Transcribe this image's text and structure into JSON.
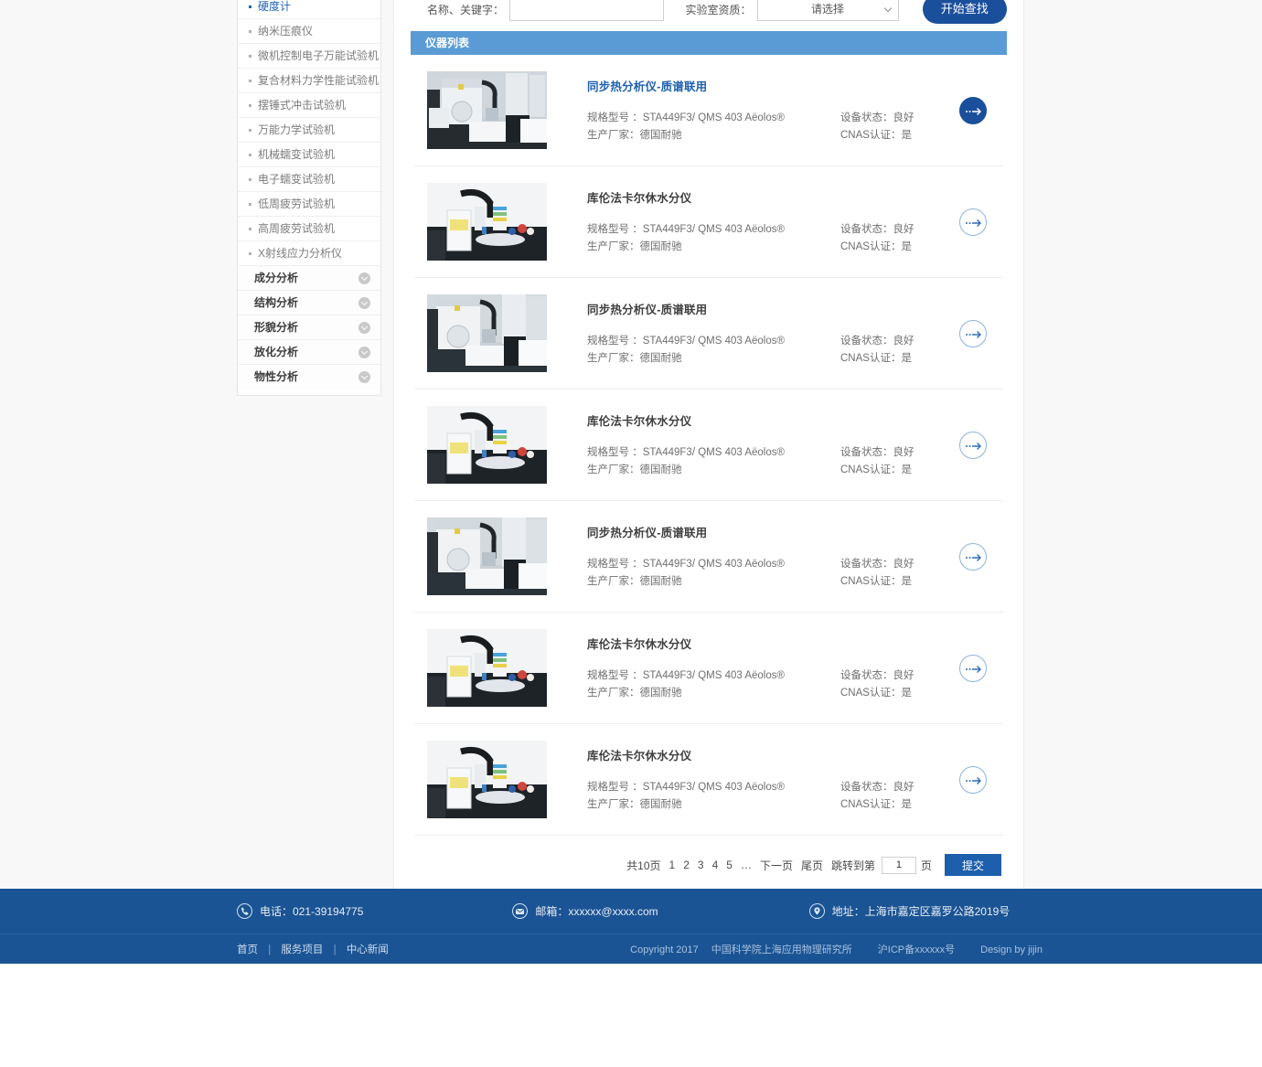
{
  "sidebar": {
    "leaf_items": [
      {
        "label": "硬度计",
        "active": true
      },
      {
        "label": "纳米压痕仪",
        "active": false
      },
      {
        "label": "微机控制电子万能试验机",
        "active": false
      },
      {
        "label": "复合材料力学性能试验机",
        "active": false
      },
      {
        "label": "摆锤式冲击试验机",
        "active": false
      },
      {
        "label": "万能力学试验机",
        "active": false
      },
      {
        "label": "机械蠕变试验机",
        "active": false
      },
      {
        "label": "电子蠕变试验机",
        "active": false
      },
      {
        "label": "低周疲劳试验机",
        "active": false
      },
      {
        "label": "高周疲劳试验机",
        "active": false
      },
      {
        "label": "X射线应力分析仪",
        "active": false
      }
    ],
    "groups": [
      {
        "label": "成分分析",
        "icon": "chevron-down-icon"
      },
      {
        "label": "结构分析",
        "icon": "chevron-down-icon"
      },
      {
        "label": "形貌分析",
        "icon": "chevron-down-icon"
      },
      {
        "label": "放化分析",
        "icon": "chevron-down-icon"
      },
      {
        "label": "物性分析",
        "icon": "chevron-down-icon"
      }
    ]
  },
  "search": {
    "keyword_label": "名称、关键字：",
    "keyword_value": "",
    "keyword_placeholder": "",
    "qualification_label": "实验室资质：",
    "qualification_selected": "请选择",
    "qualification_options": [
      "请选择"
    ],
    "submit_label": "开始查找"
  },
  "list": {
    "header": "仪器列表",
    "labels": {
      "model": "规格型号",
      "manufacturer": "生产厂家",
      "status": "设备状态",
      "cnas": "CNAS认证"
    },
    "items": [
      {
        "title": "同步热分析仪-质谱联用",
        "model": "规格型号 ：STA449F3/ QMS 403 Aëolos®",
        "manufacturer": "生产厂家：德国耐驰",
        "status": "设备状态：良好",
        "cnas": "CNAS认证：是",
        "featured": true,
        "image": "instrument-photo-1"
      },
      {
        "title": "库伦法卡尔休水分仪",
        "model": "规格型号 ：STA449F3/ QMS 403 Aëolos®",
        "manufacturer": "生产厂家：德国耐驰",
        "status": "设备状态：良好",
        "cnas": "CNAS认证：是",
        "featured": false,
        "image": "instrument-photo-2"
      },
      {
        "title": "同步热分析仪-质谱联用",
        "model": "规格型号 ：STA449F3/ QMS 403 Aëolos®",
        "manufacturer": "生产厂家：德国耐驰",
        "status": "设备状态：良好",
        "cnas": "CNAS认证：是",
        "featured": false,
        "image": "instrument-photo-3"
      },
      {
        "title": "库伦法卡尔休水分仪",
        "model": "规格型号 ：STA449F3/ QMS 403 Aëolos®",
        "manufacturer": "生产厂家：德国耐驰",
        "status": "设备状态：良好",
        "cnas": "CNAS认证：是",
        "featured": false,
        "image": "instrument-photo-2"
      },
      {
        "title": "同步热分析仪-质谱联用",
        "model": "规格型号 ：STA449F3/ QMS 403 Aëolos®",
        "manufacturer": "生产厂家：德国耐驰",
        "status": "设备状态：良好",
        "cnas": "CNAS认证：是",
        "featured": false,
        "image": "instrument-photo-3"
      },
      {
        "title": "库伦法卡尔休水分仪",
        "model": "规格型号 ：STA449F3/ QMS 403 Aëolos®",
        "manufacturer": "生产厂家：德国耐驰",
        "status": "设备状态：良好",
        "cnas": "CNAS认证：是",
        "featured": false,
        "image": "instrument-photo-2"
      },
      {
        "title": "库伦法卡尔休水分仪",
        "model": "规格型号 ：STA449F3/ QMS 403 Aëolos®",
        "manufacturer": "生产厂家：德国耐驰",
        "status": "设备状态：良好",
        "cnas": "CNAS认证：是",
        "featured": false,
        "image": "instrument-photo-2"
      }
    ]
  },
  "pagination": {
    "total_text": "共10页",
    "pages": [
      "1",
      "2",
      "3",
      "4",
      "5"
    ],
    "ellipsis": "…",
    "next_label": "下一页",
    "last_label": "尾页",
    "jump_prefix": "跳转到第",
    "jump_value": "1",
    "jump_suffix": "页",
    "submit_label": "提交"
  },
  "footer": {
    "phone": "电话：021-39194775",
    "phone_icon": "phone-icon",
    "email": "邮箱：xxxxxx@xxxx.com",
    "email_icon": "mail-icon",
    "address": "地址：上海市嘉定区嘉罗公路2019号",
    "address_icon": "location-pin-icon",
    "nav": [
      "首页",
      "服务项目",
      "中心新闻"
    ],
    "nav_separator": "|",
    "copyright": "Copyright 2017",
    "org": "中国科学院上海应用物理研究所",
    "icp": "沪ICP备xxxxxx号",
    "design": "Design by jijin"
  },
  "colors": {
    "brand_dark_blue": "#1a4f9c",
    "list_header_blue": "#5b9bd5",
    "footer_blue": "#1b5494",
    "link_blue": "#1d5fad"
  }
}
